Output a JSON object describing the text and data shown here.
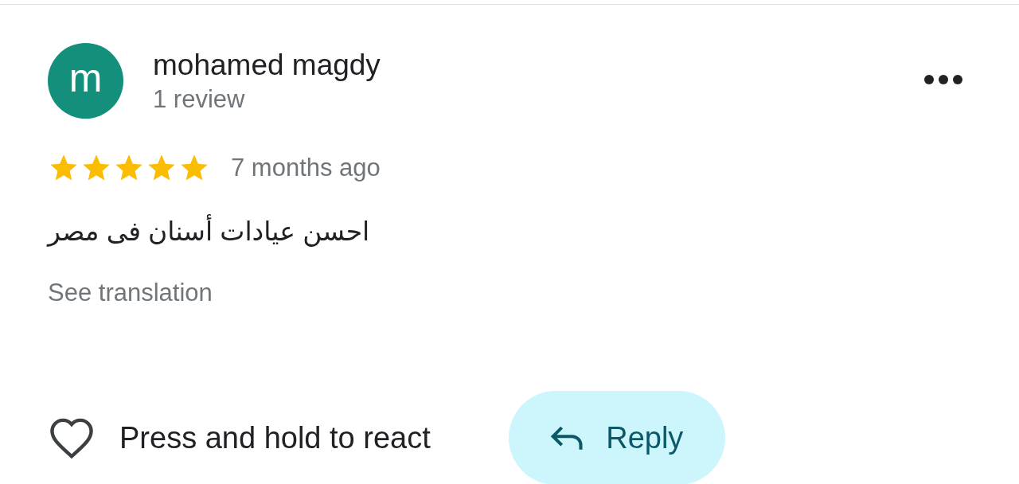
{
  "review": {
    "author": {
      "name": "mohamed magdy",
      "initial": "m",
      "review_count": "1 review"
    },
    "stars": 5,
    "time": "7 months ago",
    "text": "احسن عيادات أسنان فى مصر",
    "translate_link": "See translation",
    "react_label": "Press and hold to react",
    "reply_button": "Reply"
  }
}
